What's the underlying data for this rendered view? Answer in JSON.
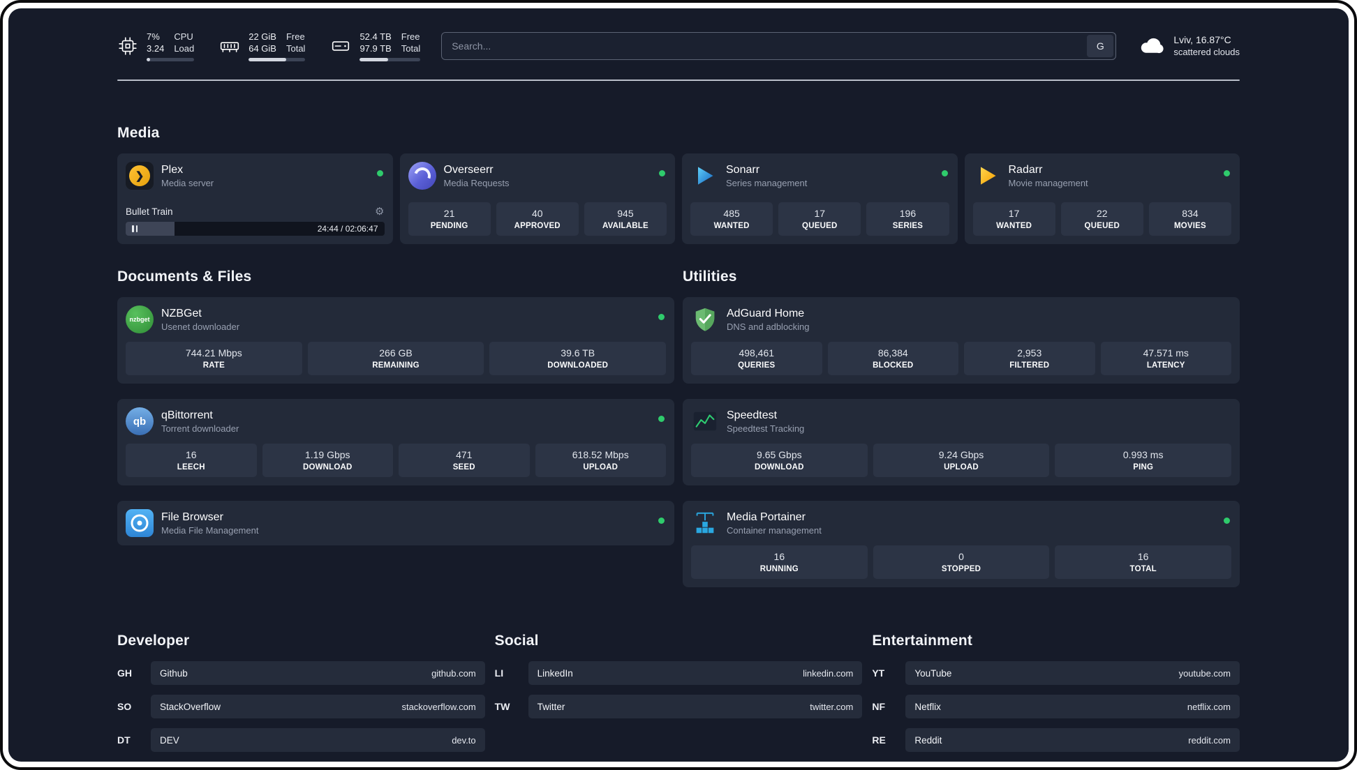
{
  "colors": {
    "background": "#161b29",
    "card": "#232a39",
    "stat_box": "#2c3445",
    "status_online": "#2fcb6c",
    "plex_amber": "#e5a00d",
    "accent_blue": "#2aa7e0"
  },
  "topbar": {
    "cpu": {
      "value_line1": "7%",
      "value_line2": "3.24",
      "label_line1": "CPU",
      "label_line2": "Load",
      "bar": "7%"
    },
    "ram": {
      "value_line1": "22 GiB",
      "value_line2": "64 GiB",
      "label_line1": "Free",
      "label_line2": "Total",
      "bar": "66%"
    },
    "disk": {
      "value_line1": "52.4 TB",
      "value_line2": "97.9 TB",
      "label_line1": "Free",
      "label_line2": "Total",
      "bar": "47%"
    },
    "search": {
      "placeholder": "Search...",
      "engine_button": "G"
    },
    "weather": {
      "location": "Lviv, 16.87°C",
      "condition": "scattered clouds"
    }
  },
  "icons": {
    "nzbget_label": "nzbget",
    "qb_label": "qb"
  },
  "media": {
    "title": "Media",
    "plex": {
      "name": "Plex",
      "desc": "Media server",
      "now_playing": "Bullet Train",
      "time": "24:44 / 02:06:47",
      "progress": "19%"
    },
    "cards": [
      {
        "name": "Overseerr",
        "desc": "Media Requests",
        "stats": [
          {
            "value": "21",
            "label": "PENDING"
          },
          {
            "value": "40",
            "label": "APPROVED"
          },
          {
            "value": "945",
            "label": "AVAILABLE"
          }
        ]
      },
      {
        "name": "Sonarr",
        "desc": "Series management",
        "stats": [
          {
            "value": "485",
            "label": "WANTED"
          },
          {
            "value": "17",
            "label": "QUEUED"
          },
          {
            "value": "196",
            "label": "SERIES"
          }
        ]
      },
      {
        "name": "Radarr",
        "desc": "Movie management",
        "stats": [
          {
            "value": "17",
            "label": "WANTED"
          },
          {
            "value": "22",
            "label": "QUEUED"
          },
          {
            "value": "834",
            "label": "MOVIES"
          }
        ]
      }
    ]
  },
  "documents": {
    "title": "Documents & Files",
    "cards": [
      {
        "name": "NZBGet",
        "desc": "Usenet downloader",
        "stats": [
          {
            "value": "744.21 Mbps",
            "label": "RATE"
          },
          {
            "value": "266 GB",
            "label": "REMAINING"
          },
          {
            "value": "39.6 TB",
            "label": "DOWNLOADED"
          }
        ]
      },
      {
        "name": "qBittorrent",
        "desc": "Torrent downloader",
        "stats": [
          {
            "value": "16",
            "label": "LEECH"
          },
          {
            "value": "1.19 Gbps",
            "label": "DOWNLOAD"
          },
          {
            "value": "471",
            "label": "SEED"
          },
          {
            "value": "618.52 Mbps",
            "label": "UPLOAD"
          }
        ]
      },
      {
        "name": "File Browser",
        "desc": "Media File Management"
      }
    ]
  },
  "utilities": {
    "title": "Utilities",
    "cards": [
      {
        "name": "AdGuard Home",
        "desc": "DNS and adblocking",
        "stats": [
          {
            "value": "498,461",
            "label": "QUERIES"
          },
          {
            "value": "86,384",
            "label": "BLOCKED"
          },
          {
            "value": "2,953",
            "label": "FILTERED"
          },
          {
            "value": "47.571 ms",
            "label": "LATENCY"
          }
        ]
      },
      {
        "name": "Speedtest",
        "desc": "Speedtest Tracking",
        "stats": [
          {
            "value": "9.65 Gbps",
            "label": "DOWNLOAD"
          },
          {
            "value": "9.24 Gbps",
            "label": "UPLOAD"
          },
          {
            "value": "0.993 ms",
            "label": "PING"
          }
        ]
      },
      {
        "name": "Media Portainer",
        "desc": "Container management",
        "stats": [
          {
            "value": "16",
            "label": "RUNNING"
          },
          {
            "value": "0",
            "label": "STOPPED"
          },
          {
            "value": "16",
            "label": "TOTAL"
          }
        ]
      }
    ]
  },
  "bookmarks": {
    "developer": {
      "title": "Developer",
      "items": [
        {
          "abbr": "GH",
          "name": "Github",
          "url": "github.com"
        },
        {
          "abbr": "SO",
          "name": "StackOverflow",
          "url": "stackoverflow.com"
        },
        {
          "abbr": "DT",
          "name": "DEV",
          "url": "dev.to"
        }
      ]
    },
    "social": {
      "title": "Social",
      "items": [
        {
          "abbr": "LI",
          "name": "LinkedIn",
          "url": "linkedin.com"
        },
        {
          "abbr": "TW",
          "name": "Twitter",
          "url": "twitter.com"
        }
      ]
    },
    "entertainment": {
      "title": "Entertainment",
      "items": [
        {
          "abbr": "YT",
          "name": "YouTube",
          "url": "youtube.com"
        },
        {
          "abbr": "NF",
          "name": "Netflix",
          "url": "netflix.com"
        },
        {
          "abbr": "RE",
          "name": "Reddit",
          "url": "reddit.com"
        }
      ]
    }
  }
}
